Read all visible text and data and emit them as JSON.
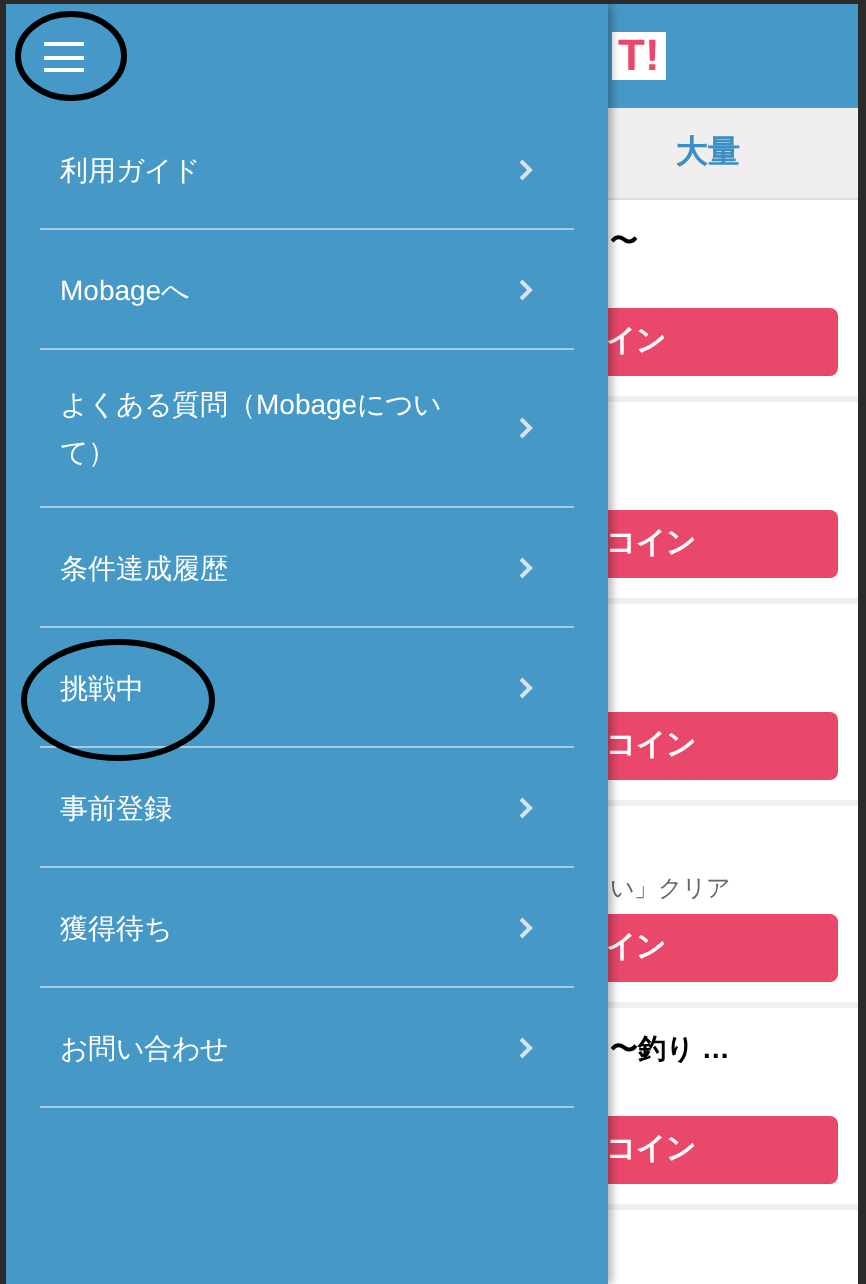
{
  "page": {
    "logo": "T!",
    "tab": "大量",
    "cards": [
      {
        "title": "〜",
        "button": "イン"
      },
      {
        "button": "コイン"
      },
      {
        "button": "コイン"
      },
      {
        "subtitle": "い」クリア",
        "button": "イン"
      },
      {
        "title": "〜釣り …",
        "button": "コイン"
      }
    ]
  },
  "drawer": {
    "items": [
      {
        "label": "利用ガイド"
      },
      {
        "label": "Mobageへ"
      },
      {
        "label": "よくある質問（Mobageについて）"
      },
      {
        "label": "条件達成履歴"
      },
      {
        "label": "挑戦中"
      },
      {
        "label": "事前登録"
      },
      {
        "label": "獲得待ち"
      },
      {
        "label": "お問い合わせ"
      }
    ]
  }
}
